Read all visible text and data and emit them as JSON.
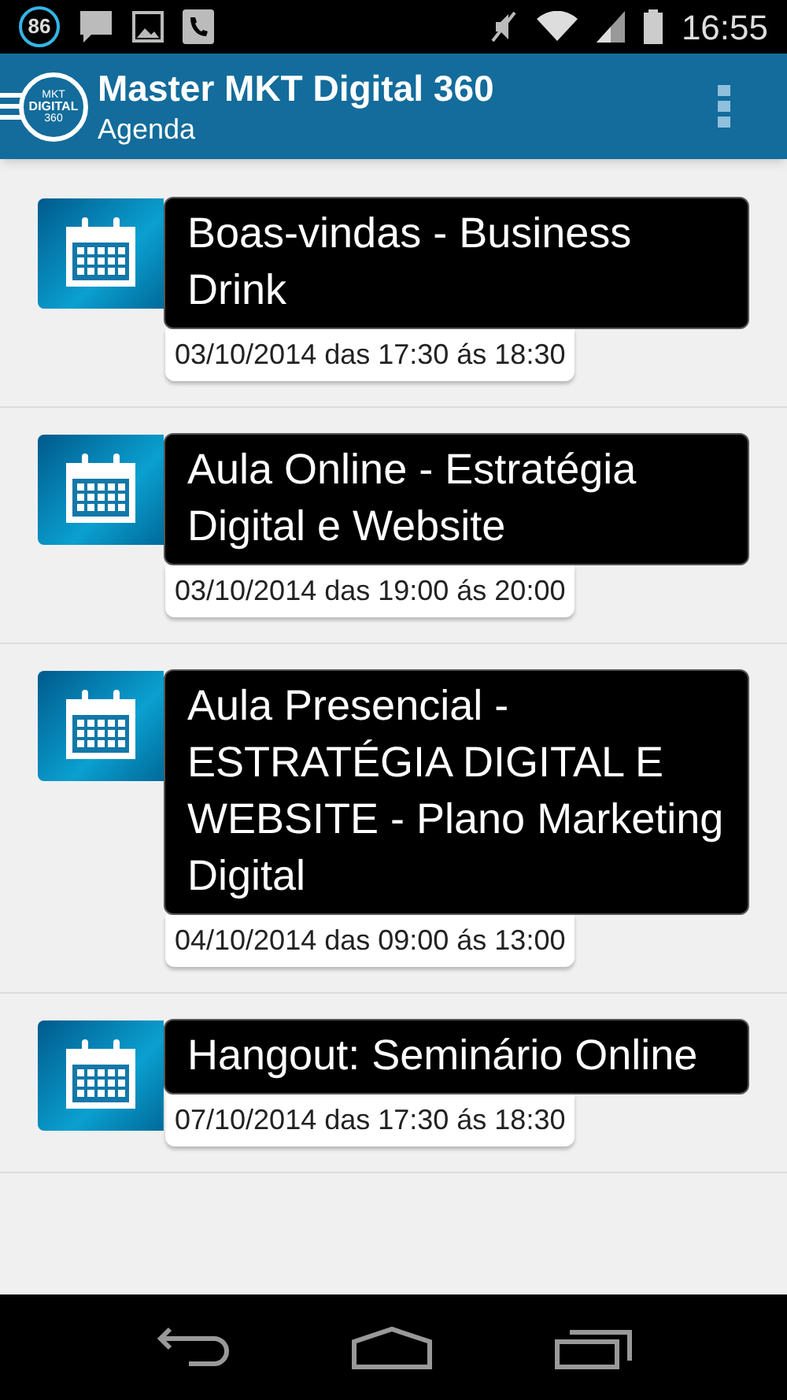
{
  "status_bar": {
    "badge": "86",
    "time": "16:55"
  },
  "app_bar": {
    "logo": {
      "line_1": "MKT",
      "line_2": "DIGITAL",
      "line_3": "360"
    },
    "title": "Master MKT Digital 360",
    "subtitle": "Agenda"
  },
  "events": [
    {
      "title": "Boas-vindas - Business Drink",
      "when": "03/10/2014 das 17:30 ás 18:30"
    },
    {
      "title": "Aula Online - Estratégia Digital e Website",
      "when": "03/10/2014 das 19:00 ás 20:00"
    },
    {
      "title": "Aula Presencial - ESTRATÉGIA DIGITAL E WEBSITE - Plano Marketing Digital",
      "when": "04/10/2014 das 09:00 ás 13:00"
    },
    {
      "title": "Hangout: Seminário Online",
      "when": "07/10/2014 das 17:30 ás 18:30"
    }
  ]
}
